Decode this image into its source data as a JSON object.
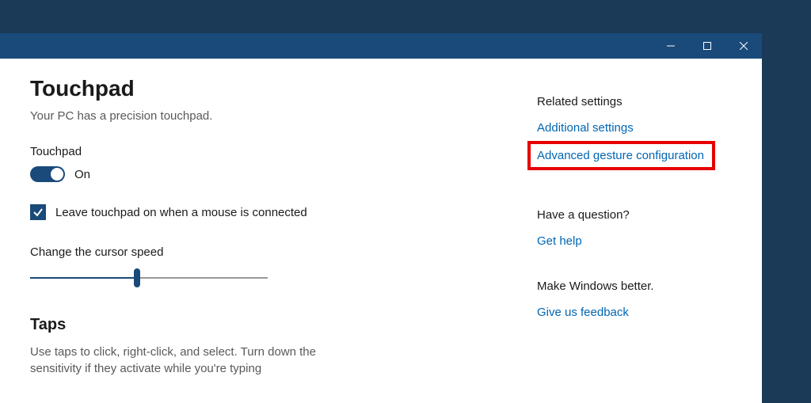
{
  "page": {
    "title": "Touchpad",
    "subtitle": "Your PC has a precision touchpad."
  },
  "touchpad_toggle": {
    "label": "Touchpad",
    "state": "On"
  },
  "mouse_checkbox": {
    "label": "Leave touchpad on when a mouse is connected",
    "checked": true
  },
  "cursor_speed": {
    "label": "Change the cursor speed"
  },
  "taps": {
    "heading": "Taps",
    "description": "Use taps to click, right-click, and select. Turn down the sensitivity if they activate while you're typing"
  },
  "related": {
    "heading": "Related settings",
    "links": {
      "additional": "Additional settings",
      "advanced": "Advanced gesture configuration"
    }
  },
  "question": {
    "heading": "Have a question?",
    "link": "Get help"
  },
  "feedback": {
    "heading": "Make Windows better.",
    "link": "Give us feedback"
  }
}
